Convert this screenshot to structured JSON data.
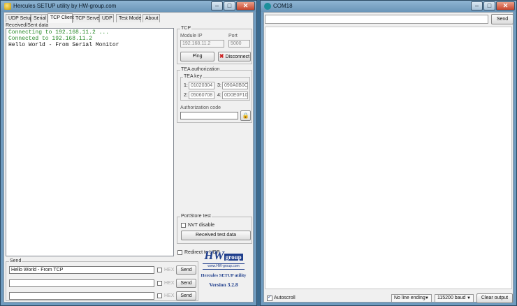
{
  "hercules": {
    "title": "Hercules SETUP utility by HW-group.com",
    "window_controls": {
      "minimize": "–",
      "maximize": "□",
      "close": "✕"
    },
    "tabs": [
      {
        "label": "UDP Setup"
      },
      {
        "label": "Serial"
      },
      {
        "label": "TCP Client",
        "active": true
      },
      {
        "label": "TCP Server"
      },
      {
        "label": "UDP"
      },
      {
        "label": "Test Mode"
      },
      {
        "label": "About"
      }
    ],
    "received_label": "Received/Sent data",
    "received_lines": [
      {
        "text": "Connecting to 192.168.11.2 ...",
        "color": "#2a8a2a"
      },
      {
        "text": "Connected to 192.168.11.2",
        "color": "#2a8a2a"
      },
      {
        "text": "Hello World - From Serial Monitor",
        "color": "#111111"
      }
    ],
    "tcp": {
      "legend": "TCP",
      "module_ip_label": "Module IP",
      "module_ip_value": "192.168.11.2",
      "port_label": "Port",
      "port_value": "5000",
      "ping_label": "Ping",
      "disconnect_label": "Disconnect",
      "disconnect_icon": "✖",
      "disconnect_icon_color": "#cc2222"
    },
    "tea": {
      "legend": "TEA authorization",
      "key_legend": "TEA key",
      "keys": [
        {
          "label": "1:",
          "value": "01020304"
        },
        {
          "label": "3:",
          "value": "090A0B0C"
        },
        {
          "label": "2:",
          "value": "05060708"
        },
        {
          "label": "4:",
          "value": "0D0E0F10"
        }
      ],
      "auth_code_label": "Authorization code",
      "lock_icon": "🔒"
    },
    "portstore": {
      "legend": "PortStore test",
      "nvt_label": "NVT disable",
      "received_test_label": "Received test data"
    },
    "redirect_label": "Redirect to UDP",
    "send": {
      "legend": "Send",
      "rows": [
        {
          "value": "Hello World - From TCP",
          "hex_label": "HEX",
          "send_label": "Send"
        },
        {
          "value": "",
          "hex_label": "HEX",
          "send_label": "Send"
        },
        {
          "value": "",
          "hex_label": "HEX",
          "send_label": "Send"
        }
      ]
    },
    "logo": {
      "mark": "HW",
      "group": "group",
      "url": "www.HW-group.com",
      "product": "Hercules SETUP utility",
      "version": "Version  3.2.8"
    }
  },
  "serial_monitor": {
    "title": "COM18",
    "window_controls": {
      "minimize": "–",
      "maximize": "□",
      "close": "✕"
    },
    "input_value": "",
    "send_label": "Send",
    "autoscroll_label": "Autoscroll",
    "line_ending": "No line ending",
    "baud": "115200 baud",
    "clear_label": "Clear output",
    "dropdown_arrow": "▼"
  },
  "colors": {
    "desktop": "#3b6a8f",
    "titlebar": "#7ea6c7",
    "logo_blue": "#1f3e8c"
  }
}
